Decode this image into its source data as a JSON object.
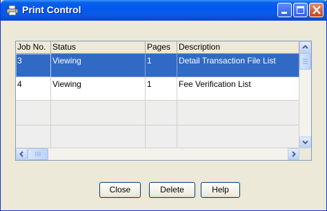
{
  "window": {
    "title": "Print Control"
  },
  "columns": [
    "Job No.",
    "Status",
    "Pages",
    "Description"
  ],
  "rows": [
    {
      "job": "3",
      "status": "Viewing",
      "pages": "1",
      "description": "Detail Transaction File List",
      "selected": true
    },
    {
      "job": "4",
      "status": "Viewing",
      "pages": "1",
      "description": "Fee Verification List",
      "selected": false
    }
  ],
  "buttons": {
    "close": "Close",
    "delete": "Delete",
    "help": "Help"
  },
  "colors": {
    "selection": "#316ac5",
    "titlebar": "#0058ee",
    "dialog": "#ece9d8"
  },
  "icons": [
    "printer-icon",
    "minimize-icon",
    "maximize-icon",
    "close-icon",
    "scroll-up-icon",
    "scroll-down-icon",
    "scroll-left-icon",
    "scroll-right-icon"
  ]
}
